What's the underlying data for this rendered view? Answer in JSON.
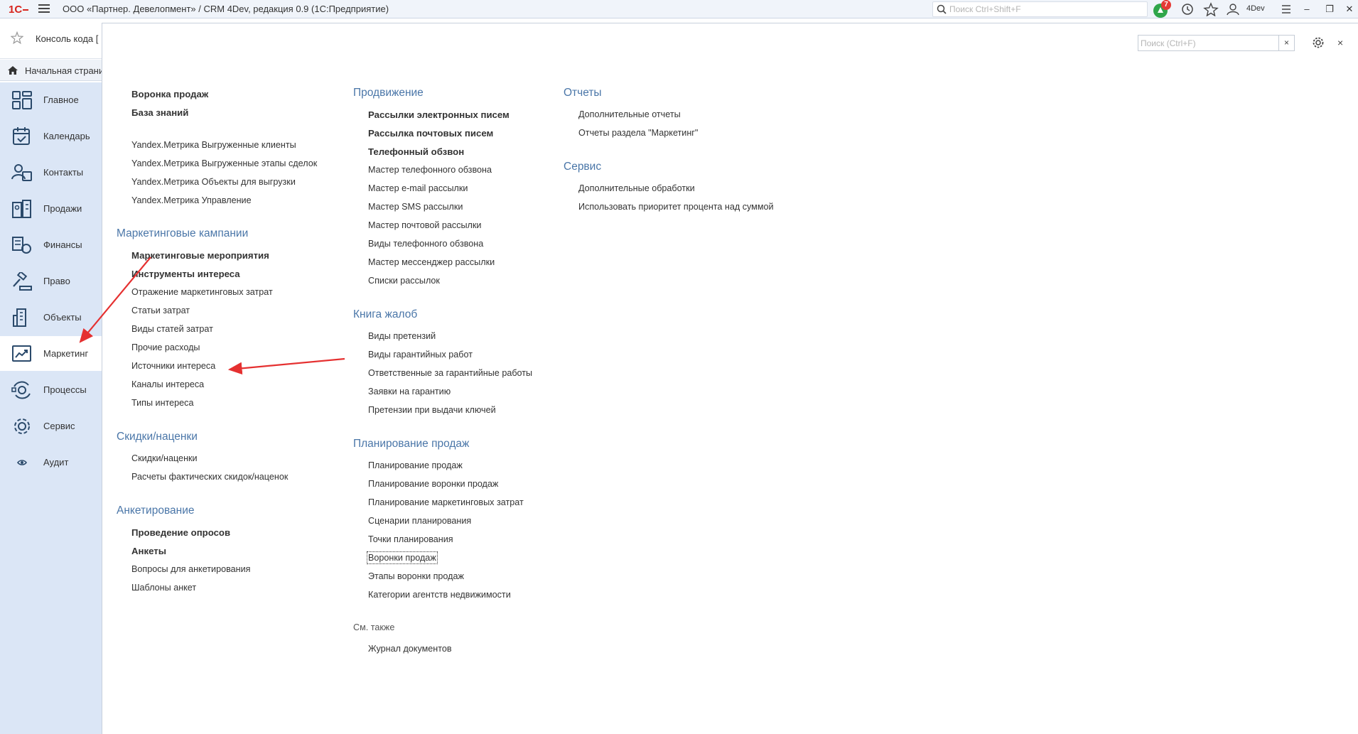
{
  "titlebar": {
    "logo_text": "1С",
    "title": "ООО «Партнер. Девелопмент» / CRM 4Dev, редакция 0.9  (1С:Предприятие)",
    "search_placeholder": "Поиск Ctrl+Shift+F",
    "notification_count": "7",
    "user": "4Dev",
    "icons": [
      "notifications-icon",
      "history-icon",
      "favorites-icon",
      "user-icon",
      "menu-icon",
      "minimize-icon",
      "restore-icon",
      "close-icon"
    ]
  },
  "open_tab": {
    "label": "Консоль кода ["
  },
  "home": {
    "label": "Начальная страни"
  },
  "sections": [
    {
      "label": "Главное",
      "icon": "main-icon"
    },
    {
      "label": "Календарь",
      "icon": "calendar-icon"
    },
    {
      "label": "Контакты",
      "icon": "contacts-icon"
    },
    {
      "label": "Продажи",
      "icon": "sales-icon"
    },
    {
      "label": "Финансы",
      "icon": "finance-icon"
    },
    {
      "label": "Право",
      "icon": "law-icon"
    },
    {
      "label": "Объекты",
      "icon": "buildings-icon"
    },
    {
      "label": "Маркетинг",
      "icon": "marketing-icon",
      "active": true
    },
    {
      "label": "Процессы",
      "icon": "processes-icon"
    },
    {
      "label": "Сервис",
      "icon": "service-icon"
    },
    {
      "label": "Аудит",
      "icon": "audit-icon"
    }
  ],
  "form": {
    "search_placeholder": "Поиск (Ctrl+F)",
    "clear_label": "×",
    "close_label": "×"
  },
  "col1": {
    "top_links": [
      "Воронка продаж",
      "База знаний"
    ],
    "yandex_links": [
      "Yandex.Метрика Выгруженные клиенты",
      "Yandex.Метрика Выгруженные этапы сделок",
      "Yandex.Метрика Объекты для выгрузки",
      "Yandex.Метрика Управление"
    ],
    "campaigns": {
      "title": "Маркетинговые кампании",
      "links": [
        "Маркетинговые мероприятия",
        "Инструменты интереса",
        "Отражение маркетинговых затрат",
        "Статьи затрат",
        "Виды статей затрат",
        "Прочие расходы",
        "Источники интереса",
        "Каналы интереса",
        "Типы интереса"
      ]
    },
    "discounts": {
      "title": "Скидки/наценки",
      "links": [
        "Скидки/наценки",
        "Расчеты фактических скидок/наценок"
      ]
    },
    "survey": {
      "title": "Анкетирование",
      "links": [
        "Проведение опросов",
        "Анкеты",
        "Вопросы для анкетирования",
        "Шаблоны анкет"
      ]
    }
  },
  "col2": {
    "promotion": {
      "title": "Продвижение",
      "links": [
        "Рассылки электронных писем",
        "Рассылка почтовых писем",
        "Телефонный обзвон",
        "Мастер телефонного обзвона",
        "Мастер e-mail рассылки",
        "Мастер SMS рассылки",
        "Мастер почтовой рассылки",
        "Виды телефонного обзвона",
        "Мастер мессенджер рассылки",
        "Списки рассылок"
      ]
    },
    "complaints": {
      "title": "Книга жалоб",
      "links": [
        "Виды претензий",
        "Виды гарантийных работ",
        "Ответственные за гарантийные работы",
        "Заявки на гарантию",
        "Претензии при выдачи ключей"
      ]
    },
    "planning": {
      "title": "Планирование продаж",
      "links": [
        "Планирование продаж",
        "Планирование воронки продаж",
        "Планирование маркетинговых затрат",
        "Сценарии планирования",
        "Точки планирования",
        "Воронки продаж",
        "Этапы воронки продаж",
        "Категории агентств недвижимости"
      ]
    },
    "see_also": {
      "title": "См. также",
      "links": [
        "Журнал документов"
      ]
    }
  },
  "col3": {
    "reports": {
      "title": "Отчеты",
      "links": [
        "Дополнительные отчеты",
        "Отчеты раздела \"Маркетинг\""
      ]
    },
    "service": {
      "title": "Сервис",
      "links": [
        "Дополнительные обработки",
        "Использовать приоритет процента над суммой"
      ]
    }
  },
  "colors": {
    "accent": "#4a76a8",
    "panel": "#dbe6f6",
    "arrow": "#e53030"
  }
}
